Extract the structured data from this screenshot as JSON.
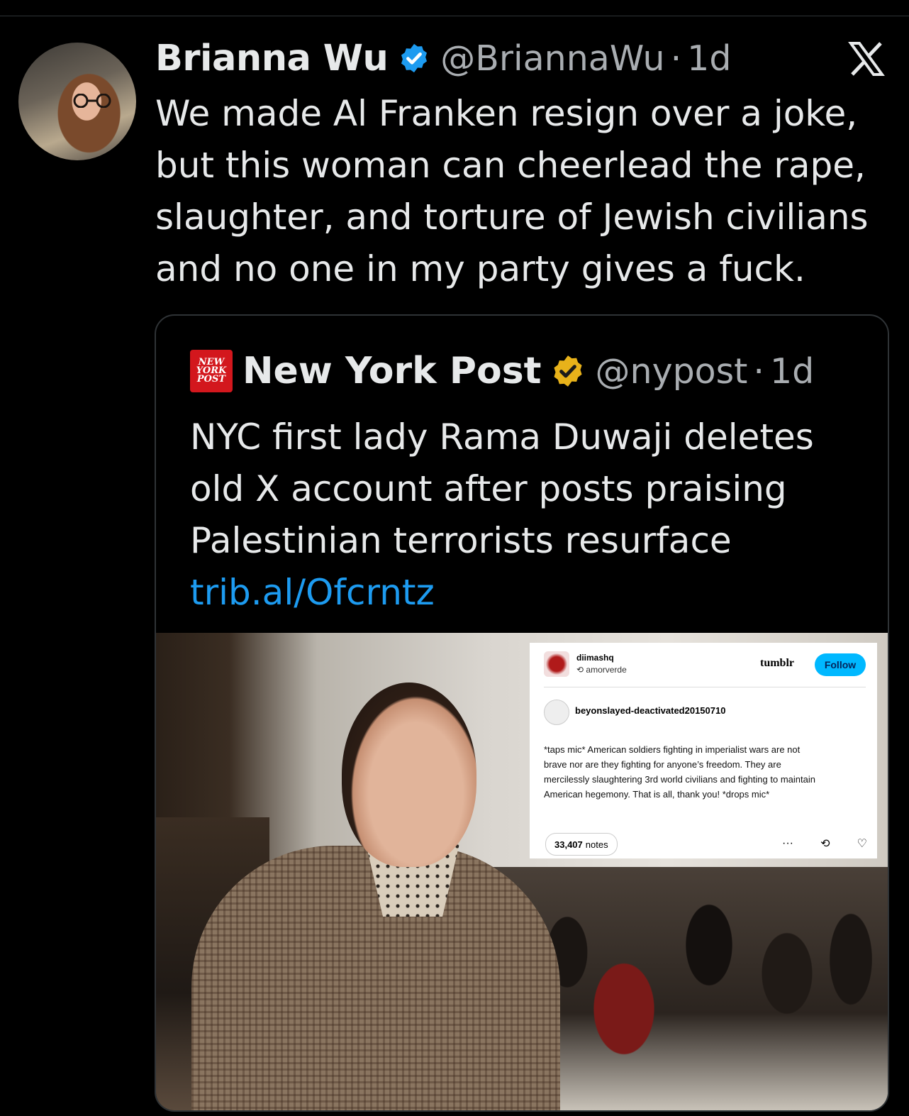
{
  "tweet": {
    "author_name": "Brianna Wu",
    "author_handle": "@BriannaWu",
    "separator": "·",
    "time": "1d",
    "text_lines": [
      "We made Al Franken resign over a joke,",
      "but this woman can cheerlead the rape,",
      "slaughter, and torture of Jewish civilians",
      "and no one in my party gives a fuck."
    ],
    "verified_color": "#1d9bf0"
  },
  "quote": {
    "author_name": "New York Post",
    "author_handle": "@nypost",
    "separator": "·",
    "time": "1d",
    "logo_lines": [
      "NEW",
      "YORK",
      "POST"
    ],
    "text_lines": [
      "NYC first lady Rama Duwaji deletes",
      "old X account after posts praising",
      "Palestinian terrorists resurface"
    ],
    "link": "trib.al/Ofcrntz",
    "verified_color": "#e8b21a"
  },
  "tumblr": {
    "user": "diimashq",
    "reblogged_from": "amorverde",
    "brand": "tumblr",
    "follow": "Follow",
    "poster": "beyonslayed-deactivated20150710",
    "body_lines": [
      "*taps mic* American soldiers fighting in imperialist wars are not",
      "brave nor are they fighting for anyone’s freedom. They are",
      "mercilessly slaughtering 3rd world civilians and fighting to maintain",
      "American hegemony. That is all, thank you! *drops mic*"
    ],
    "notes_count": "33,407",
    "notes_label": "notes",
    "more": "···"
  },
  "colors": {
    "background": "#000000",
    "link": "#1d9bf0",
    "tumblr_follow": "#00b8ff",
    "nypost_red": "#d3171d"
  }
}
